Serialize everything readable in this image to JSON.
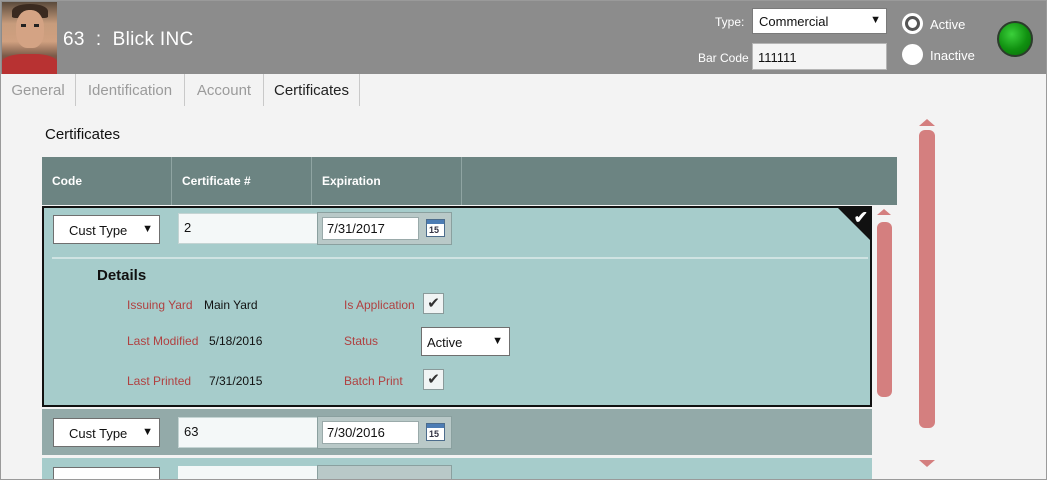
{
  "header": {
    "customer_number": "63",
    "separator": ":",
    "customer_name": "Blick INC",
    "type_label": "Type:",
    "type_value": "Commercial",
    "barcode_label": "Bar Code",
    "barcode_value": "111111",
    "active_label": "Active",
    "inactive_label": "Inactive",
    "selected_status": "Active",
    "status_color": "#1a9a1a"
  },
  "tabs": [
    {
      "label": "General",
      "active": false
    },
    {
      "label": "Identification",
      "active": false
    },
    {
      "label": "Account",
      "active": false
    },
    {
      "label": "Certificates",
      "active": true
    }
  ],
  "section_title": "Certificates",
  "grid": {
    "columns": [
      "Code",
      "Certificate #",
      "Expiration"
    ],
    "rows": [
      {
        "code": "Cust Type",
        "certificate": "2",
        "expiration": "7/31/2017",
        "expanded": true,
        "details": {
          "title": "Details",
          "issuing_yard_label": "Issuing Yard",
          "issuing_yard": "Main Yard",
          "last_modified_label": "Last Modified",
          "last_modified": "5/18/2016",
          "last_printed_label": "Last Printed",
          "last_printed": "7/31/2015",
          "is_application_label": "Is Application",
          "is_application": true,
          "status_label": "Status",
          "status": "Active",
          "batch_print_label": "Batch Print",
          "batch_print": true
        }
      },
      {
        "code": "Cust Type",
        "certificate": "63",
        "expiration": "7/30/2016",
        "expanded": false
      }
    ]
  },
  "icons": {
    "calendar_day": "15",
    "check": "✔",
    "caret": "⌄"
  },
  "colors": {
    "header_bg": "#8c8c8c",
    "grid_header": "#6c8482",
    "row_selected": "#a6cccb",
    "row_alt": "#93aaa9",
    "detail_label": "#b04040",
    "scrollbar": "#d47f7f"
  }
}
